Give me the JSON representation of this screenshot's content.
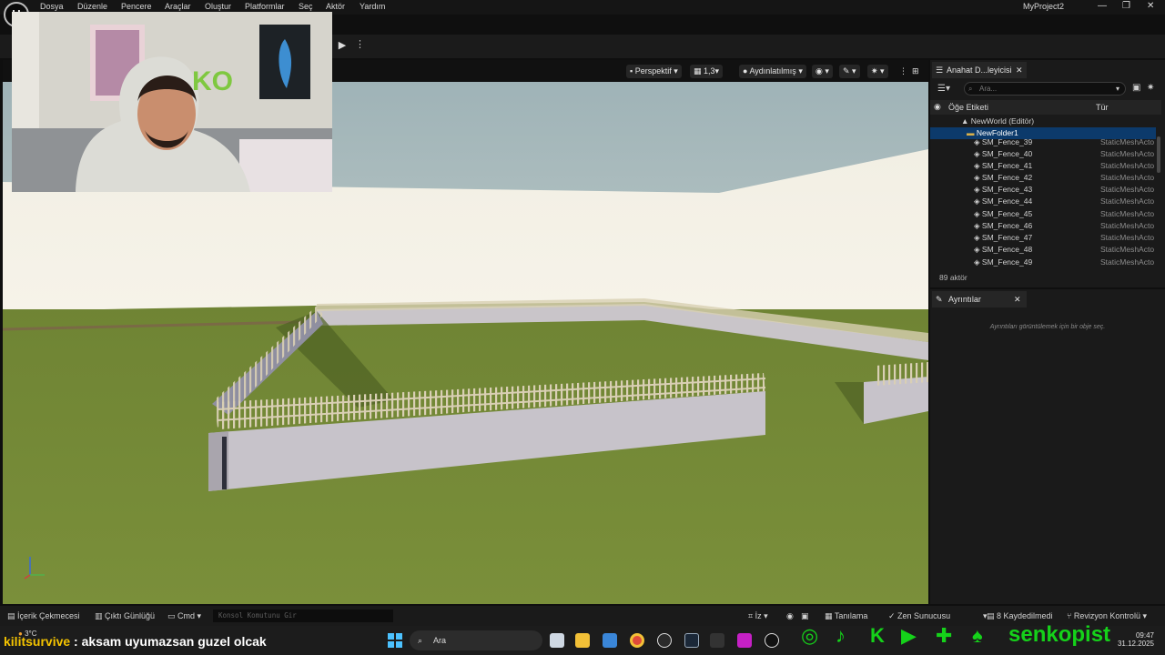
{
  "window": {
    "project_name": "MyProject2",
    "logo_glyph": "U"
  },
  "menubar": {
    "items": [
      "Dosya",
      "Düzenle",
      "Pencere",
      "Araçlar",
      "Oluştur",
      "Platformlar",
      "Seç",
      "Aktör",
      "Yardım"
    ]
  },
  "viewport_toolbar": {
    "perspective": "Perspektif",
    "fov": "1,3",
    "lighting": "Aydınlatılmış"
  },
  "outliner": {
    "tab_label": "Anahat D...leyicisi",
    "search_placeholder": "Ara...",
    "col_label": "Öğe Etiketi",
    "col_type": "Tür",
    "world": "NewWorld (Editör)",
    "folder": "NewFolder1",
    "rows": [
      {
        "name": "SM_Fence_39",
        "type": "StaticMeshActo"
      },
      {
        "name": "SM_Fence_40",
        "type": "StaticMeshActo"
      },
      {
        "name": "SM_Fence_41",
        "type": "StaticMeshActo"
      },
      {
        "name": "SM_Fence_42",
        "type": "StaticMeshActo"
      },
      {
        "name": "SM_Fence_43",
        "type": "StaticMeshActo"
      },
      {
        "name": "SM_Fence_44",
        "type": "StaticMeshActo"
      },
      {
        "name": "SM_Fence_45",
        "type": "StaticMeshActo"
      },
      {
        "name": "SM_Fence_46",
        "type": "StaticMeshActo"
      },
      {
        "name": "SM_Fence_47",
        "type": "StaticMeshActo"
      },
      {
        "name": "SM_Fence_48",
        "type": "StaticMeshActo"
      },
      {
        "name": "SM_Fence_49",
        "type": "StaticMeshActo"
      }
    ],
    "actor_count": "89 aktör"
  },
  "details": {
    "tab_label": "Ayrıntılar",
    "empty_text": "Ayrıntıları görüntülemek için bir obje seç."
  },
  "statusbar": {
    "content_drawer": "İçerik Çekmecesi",
    "output_log": "Çıktı Günlüğü",
    "cmd": "Cmd",
    "console_placeholder": "Konsol Komutunu Gir",
    "trace": "İz",
    "diagnostics": "Tanılama",
    "zen_server": "Zen Sunucusu",
    "saved": "8 Kaydedilmedi",
    "revision": "Revizyon Kontrolü"
  },
  "taskbar": {
    "weather": "3°C",
    "chat_user": "kilitsurvive",
    "chat_message": ": aksam uyumazsan guzel olcak",
    "search": "Ara",
    "brand": "senkopist",
    "time": "09:47",
    "date": "31.12.2025"
  },
  "colors": {
    "accent_green": "#15d21a",
    "chat_user": "#f5c400"
  },
  "icons": [
    "play-icon",
    "camera-icon",
    "eye-icon",
    "gear-icon",
    "search-icon",
    "folder-icon",
    "instagram-icon",
    "tiktok-icon",
    "kick-icon",
    "youtube-icon",
    "thumbs-up-icon",
    "bell-icon"
  ]
}
